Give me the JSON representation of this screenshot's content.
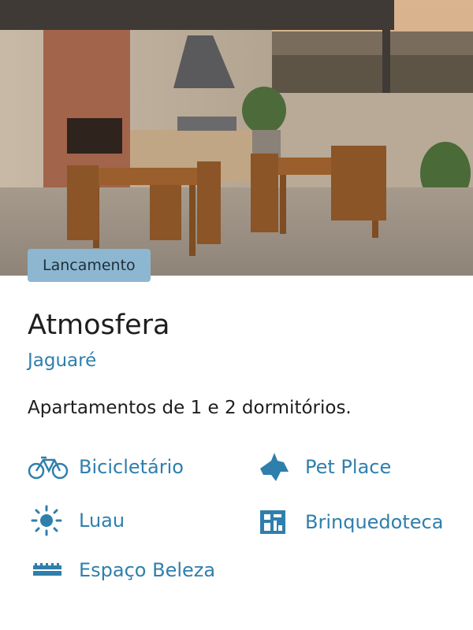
{
  "card": {
    "badge": "Lancamento",
    "title": "Atmosfera",
    "location": "Jaguaré",
    "description": "Apartamentos de 1 e 2 dormitórios."
  },
  "hero": {
    "image": "rooftop-barbecue-terrace-photo"
  },
  "amenities": [
    {
      "label": "Bicicletário",
      "icon": "bicycle-icon"
    },
    {
      "label": "Pet Place",
      "icon": "dog-icon"
    },
    {
      "label": "Luau",
      "icon": "sun-icon"
    },
    {
      "label": "Brinquedoteca",
      "icon": "playroom-icon"
    },
    {
      "label": "Espaço Beleza",
      "icon": "salon-icon"
    }
  ],
  "colors": {
    "accent": "#2f7fac",
    "badge_bg": "#8db7d1",
    "text": "#1e1e1e"
  }
}
